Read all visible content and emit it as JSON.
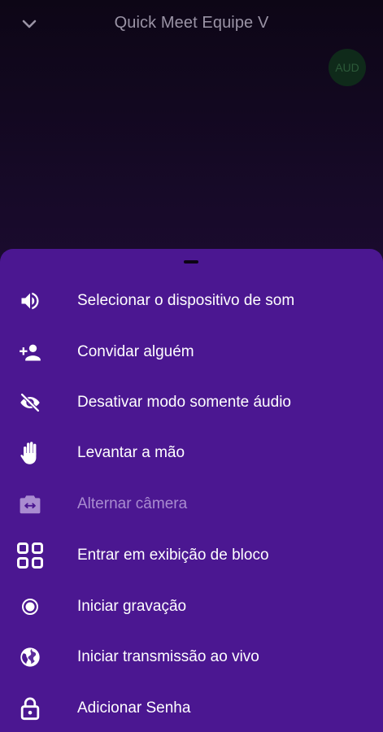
{
  "header": {
    "title": "Quick Meet Equipe V",
    "collapse_icon": "chevron-down-icon"
  },
  "participant": {
    "avatar_initials": "AUD"
  },
  "menu": {
    "items": [
      {
        "label": "Selecionar o dispositivo de som",
        "icon": "volume-icon",
        "enabled": true
      },
      {
        "label": "Convidar alguém",
        "icon": "add-person-icon",
        "enabled": true
      },
      {
        "label": "Desativar modo somente áudio",
        "icon": "eye-off-icon",
        "enabled": true
      },
      {
        "label": "Levantar a mão",
        "icon": "hand-icon",
        "enabled": true
      },
      {
        "label": "Alternar câmera",
        "icon": "switch-camera-icon",
        "enabled": false
      },
      {
        "label": "Entrar em exibição de bloco",
        "icon": "grid-icon",
        "enabled": true
      },
      {
        "label": "Iniciar gravação",
        "icon": "record-icon",
        "enabled": true
      },
      {
        "label": "Iniciar transmissão ao vivo",
        "icon": "globe-icon",
        "enabled": true
      },
      {
        "label": "Adicionar Senha",
        "icon": "lock-icon",
        "enabled": true
      }
    ]
  },
  "colors": {
    "sheet": "#4b1791",
    "text": "#ffffff",
    "disabled_text": "#a98cd0",
    "background": "#1a0b2e"
  }
}
